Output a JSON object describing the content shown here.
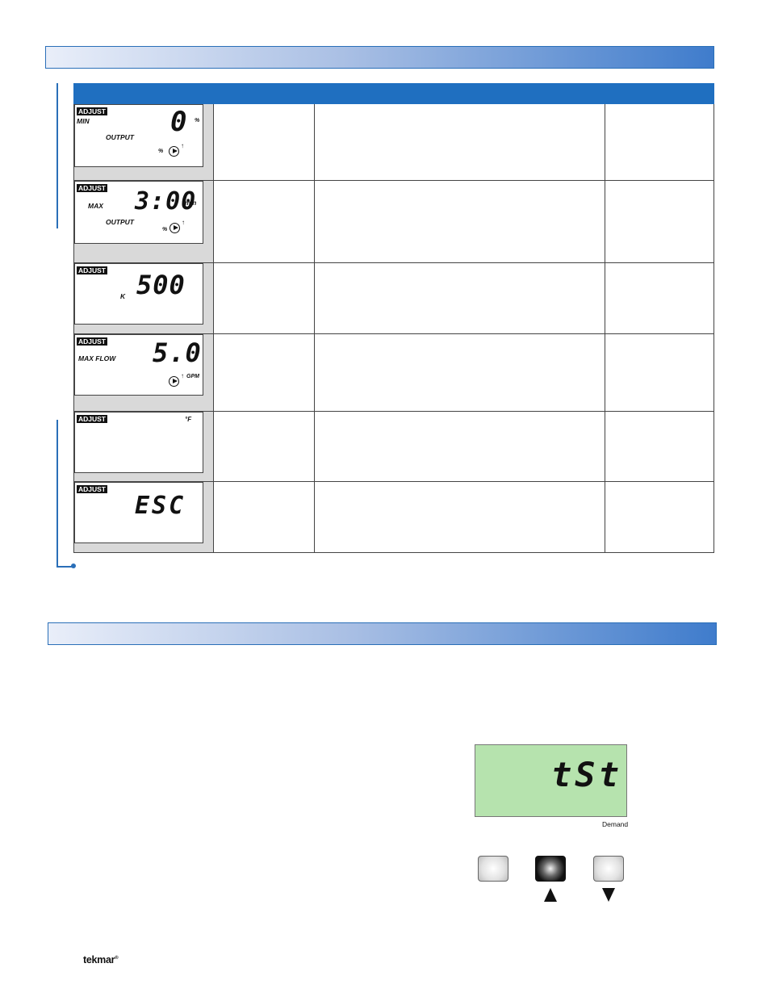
{
  "table": {
    "rows": [
      {
        "lcd": {
          "tag": "ADJUST",
          "label1": "MIN",
          "label2": "OUTPUT",
          "value": "0",
          "unit": "%",
          "icon": "pump-icon",
          "extra": "%"
        }
      },
      {
        "lcd": {
          "tag": "ADJUST",
          "label1": "MAX",
          "label2": "OUTPUT",
          "value": "3:00",
          "unit": "min",
          "icon": "pump-icon",
          "extra": "%"
        }
      },
      {
        "lcd": {
          "tag": "ADJUST",
          "label1": "K",
          "value": "500"
        }
      },
      {
        "lcd": {
          "tag": "ADJUST",
          "label1": "MAX FLOW",
          "value": "5.0",
          "unit": "GPM",
          "icon": "pump-icon"
        }
      },
      {
        "lcd": {
          "tag": "ADJUST",
          "unit": "°F"
        }
      },
      {
        "lcd": {
          "tag": "ADJUST",
          "value": "ESC"
        }
      }
    ]
  },
  "test_display": {
    "value": "tSt",
    "label": "Demand"
  },
  "brand": {
    "logo": "tekmar",
    "reg": "®"
  },
  "colors": {
    "accent": "#1f6fc0",
    "lcd_green": "#b6e3ae"
  }
}
